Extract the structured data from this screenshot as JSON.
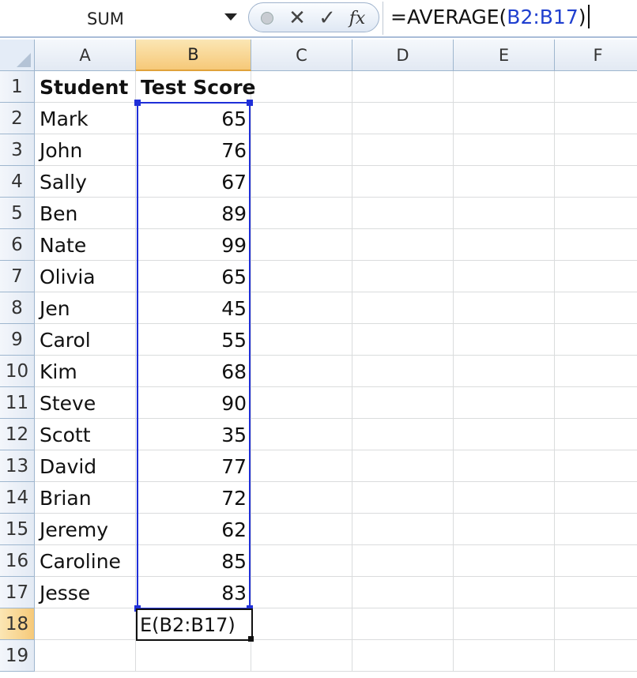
{
  "formula_bar": {
    "name_box": "SUM",
    "formula_prefix": "=AVERAGE(",
    "formula_ref": "B2:B17",
    "formula_suffix": ")",
    "fx_label": "fx",
    "cancel_glyph": "✕",
    "enter_glyph": "✓"
  },
  "columns": [
    "A",
    "B",
    "C",
    "D",
    "E",
    "F"
  ],
  "active_column": "B",
  "rows": [
    {
      "num": "1",
      "a": "Student",
      "b": "Test Score"
    },
    {
      "num": "2",
      "a": "Mark",
      "b": "65"
    },
    {
      "num": "3",
      "a": "John",
      "b": "76"
    },
    {
      "num": "4",
      "a": "Sally",
      "b": "67"
    },
    {
      "num": "5",
      "a": "Ben",
      "b": "89"
    },
    {
      "num": "6",
      "a": "Nate",
      "b": "99"
    },
    {
      "num": "7",
      "a": "Olivia",
      "b": "65"
    },
    {
      "num": "8",
      "a": "Jen",
      "b": "45"
    },
    {
      "num": "9",
      "a": "Carol",
      "b": "55"
    },
    {
      "num": "10",
      "a": "Kim",
      "b": "68"
    },
    {
      "num": "11",
      "a": "Steve",
      "b": "90"
    },
    {
      "num": "12",
      "a": "Scott",
      "b": "35"
    },
    {
      "num": "13",
      "a": "David",
      "b": "77"
    },
    {
      "num": "14",
      "a": "Brian",
      "b": "72"
    },
    {
      "num": "15",
      "a": "Jeremy",
      "b": "62"
    },
    {
      "num": "16",
      "a": "Caroline",
      "b": "85"
    },
    {
      "num": "17",
      "a": "Jesse",
      "b": "83"
    },
    {
      "num": "18",
      "a": "",
      "b": ""
    },
    {
      "num": "19",
      "a": "",
      "b": ""
    }
  ],
  "active_row": "18",
  "editing_cell": {
    "ref": "B18",
    "visible_text": "E(B2:B17)"
  },
  "colors": {
    "range_highlight": "#1f2fd8",
    "active_header": "#f6c979",
    "header_border": "#9eb6ce"
  }
}
